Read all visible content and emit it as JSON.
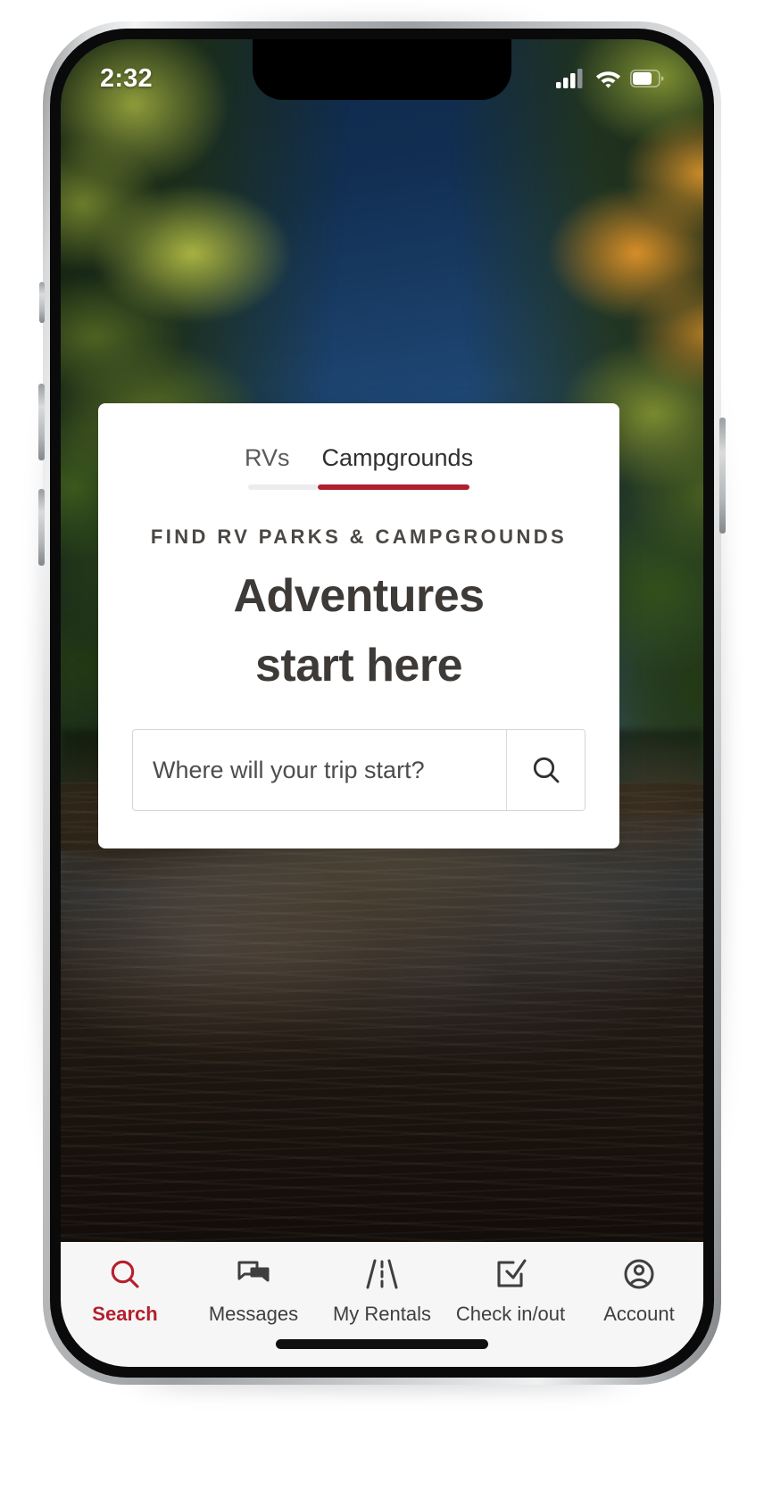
{
  "status_bar": {
    "time": "2:32",
    "cellular_icon": "cellular-signal-icon",
    "wifi_icon": "wifi-icon",
    "battery_icon": "battery-icon"
  },
  "card": {
    "tabs": [
      {
        "label": "RVs",
        "active": false
      },
      {
        "label": "Campgrounds",
        "active": true
      }
    ],
    "eyebrow": "FIND RV PARKS & CAMPGROUNDS",
    "headline_line1": "Adventures",
    "headline_line2": "start here",
    "search": {
      "value": "",
      "placeholder": "Where will your trip start?",
      "button_icon": "search-icon"
    },
    "accent_color": "#b0202c",
    "inactive_rail_color": "#ececef"
  },
  "bottom_nav": {
    "active_color": "#b5202c",
    "inactive_color": "#3f3f3f",
    "items": [
      {
        "label": "Search",
        "icon": "search-icon",
        "active": true
      },
      {
        "label": "Messages",
        "icon": "messages-icon",
        "active": false
      },
      {
        "label": "My Rentals",
        "icon": "road-icon",
        "active": false
      },
      {
        "label": "Check in/out",
        "icon": "checkbox-check-icon",
        "active": false
      },
      {
        "label": "Account",
        "icon": "account-circle-icon",
        "active": false
      }
    ]
  }
}
